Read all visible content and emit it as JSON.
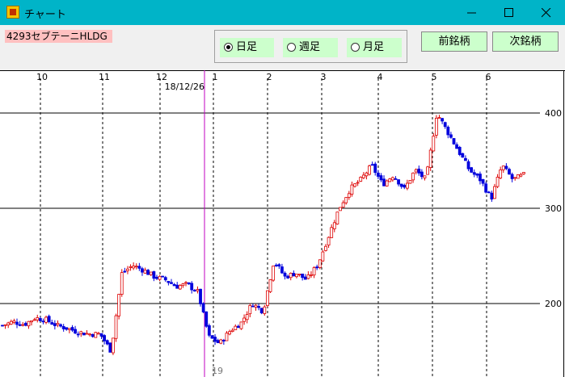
{
  "window": {
    "title": "チャート"
  },
  "toolbar": {
    "symbol": "4293セブテーニHLDG",
    "periods": [
      "日足",
      "週足",
      "月足"
    ],
    "selected_period": "日足",
    "prev_label": "前銘柄",
    "next_label": "次銘柄"
  },
  "colors": {
    "titlebar": "#00b4c8",
    "button_bg": "#ccffcc",
    "symbol_bg": "#ffc0c0",
    "up": "#dd0000",
    "down": "#0000dd",
    "cursor": "#c000c0"
  },
  "chart": {
    "month_labels": [
      "10",
      "11",
      "12",
      "1",
      "2",
      "3",
      "4",
      "5",
      "6"
    ],
    "cursor_date": "18/12/26",
    "cursor_year": "19",
    "y_ticks": [
      400,
      300,
      200
    ]
  },
  "chart_data": {
    "type": "candlestick",
    "title": "4293セブテーニHLDG",
    "y_ticks": [
      400,
      300,
      200
    ],
    "x_month_labels": [
      "10",
      "11",
      "12",
      "1",
      "2",
      "3",
      "4",
      "5",
      "6"
    ],
    "close_approx": [
      177,
      181,
      178,
      185,
      183,
      177,
      174,
      170,
      168,
      168,
      150,
      232,
      240,
      235,
      228,
      225,
      218,
      220,
      212,
      165,
      158,
      172,
      180,
      200,
      192,
      245,
      228,
      232,
      225,
      240,
      270,
      300,
      320,
      330,
      345,
      325,
      335,
      320,
      340,
      330,
      400,
      380,
      360,
      340,
      330,
      310,
      345,
      330,
      335
    ]
  }
}
